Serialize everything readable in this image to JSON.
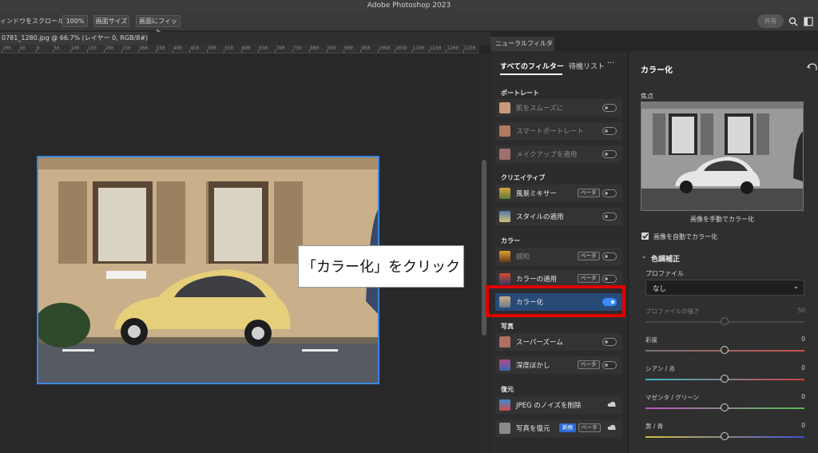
{
  "app": {
    "title": "Adobe Photoshop 2023"
  },
  "options_bar": {
    "scroll_all": "ィンドウをスクロール",
    "zoom": "100%",
    "fit_screen": "画面サイズ",
    "fill_screen": "画面にフィット",
    "share": "共有"
  },
  "document": {
    "tab": "0781_1280.jpg @ 66.7% (レイヤー 0, RGB/8#) *"
  },
  "ruler": {
    "ticks": [
      "100",
      "50",
      "0",
      "50",
      "100",
      "150",
      "200",
      "250",
      "300",
      "350",
      "400",
      "450",
      "500",
      "550",
      "600",
      "650",
      "700",
      "750",
      "800",
      "850",
      "900",
      "950",
      "1000",
      "1050",
      "1100",
      "1150",
      "1200",
      "1250"
    ]
  },
  "callout": {
    "text": "「カラー化」をクリック"
  },
  "neural": {
    "panel_tab": "ニューラルフィルター",
    "tabs": {
      "all": "すべてのフィルター",
      "wait": "待機リスト",
      "more": "···"
    },
    "sections": {
      "portrait": "ポートレート",
      "creative": "クリエイティブ",
      "color": "カラー",
      "photo": "写真",
      "restore": "復元"
    },
    "items": {
      "smooth": "肌をスムーズに",
      "smart": "スマートポートレート",
      "makeup": "メイクアップを適用",
      "landscape": "風景ミキサー",
      "style": "スタイルの適用",
      "harmony": "調和",
      "color_transfer": "カラーの適用",
      "colorize": "カラー化",
      "superzoom": "スーパーズーム",
      "depth": "深度ぼかし",
      "jpeg": "JPEG のノイズを削除",
      "restore": "写真を復元"
    },
    "badges": {
      "beta": "ベータ",
      "new": "新規"
    }
  },
  "colorize_panel": {
    "title": "カラー化",
    "focus": "焦点",
    "manual": "画像を手動でカラー化",
    "auto": "画像を自動でカラー化",
    "tone": "色調補正",
    "profile_label": "プロファイル",
    "profile_value": "なし",
    "sliders": [
      {
        "label": "プロファイルの強さ",
        "value": "50",
        "dim": true
      },
      {
        "label": "彩度",
        "value": "0"
      },
      {
        "label": "シアン / 赤",
        "value": "0"
      },
      {
        "label": "マゼンタ / グリーン",
        "value": "0"
      },
      {
        "label": "黄 / 青",
        "value": "0"
      }
    ]
  },
  "colors": {
    "accent": "#3a86e0",
    "highlight": "#e00000",
    "selected": "#284a77"
  }
}
